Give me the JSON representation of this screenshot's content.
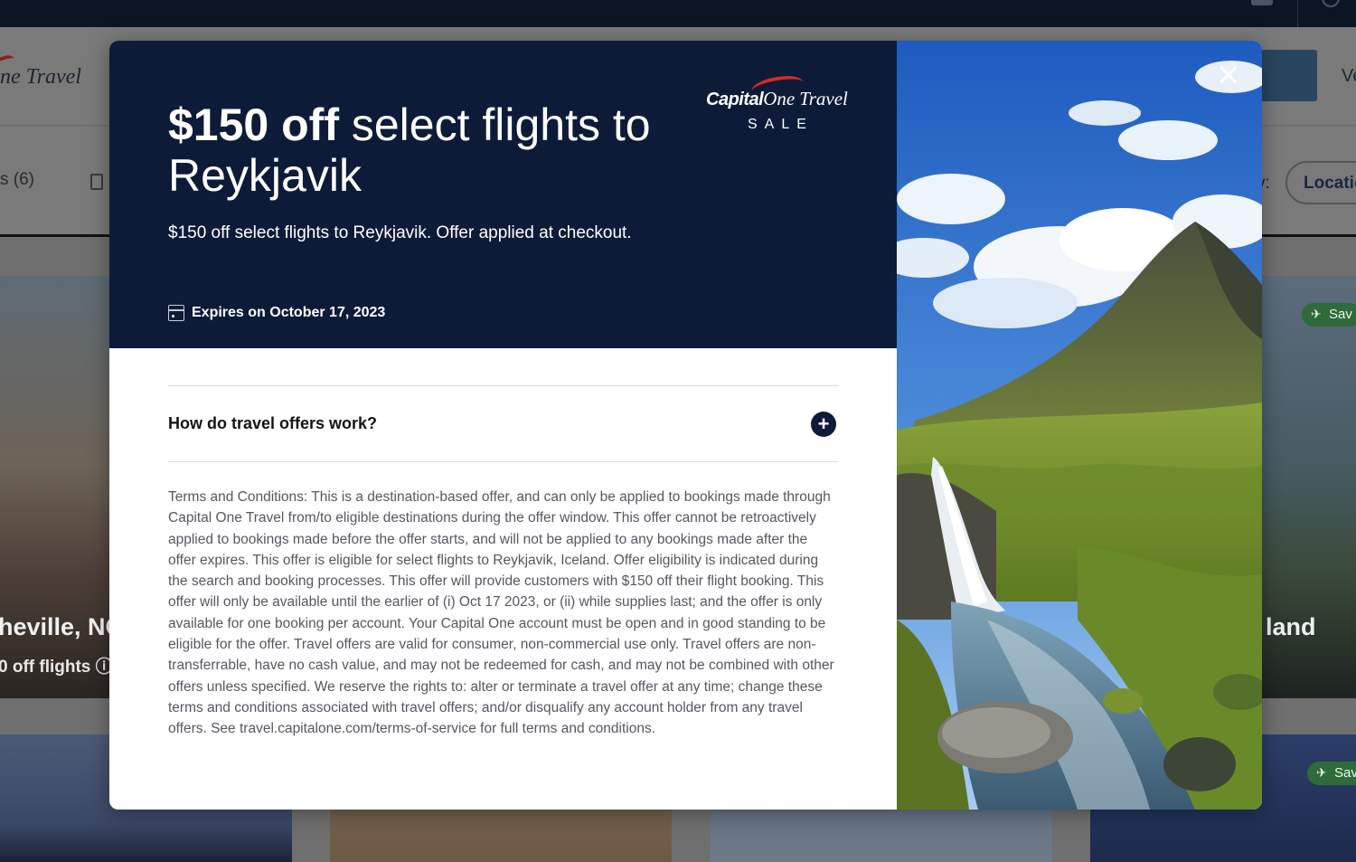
{
  "background": {
    "logo_text": "ne Travel",
    "header_right_text": "Ve",
    "filter_left_text": "s (6)",
    "sort_label": "y:",
    "sort_value": "Locatio",
    "left_tile": {
      "title": "heville, NC",
      "subtitle": "0 off flights ⓘ"
    },
    "right_tile": {
      "title": "land",
      "save_label": "Sav"
    },
    "right_tile_bottom": {
      "save_label": "Sav"
    }
  },
  "modal": {
    "title_bold": "$150 off",
    "title_rest": " select flights to Reykjavik",
    "subtitle": "$150 off select flights to Reykjavik. Offer applied at checkout.",
    "expiry": "Expires on October 17, 2023",
    "brand": {
      "capital": "Capital",
      "one": "One",
      "travel": "Travel",
      "sale": "SALE"
    },
    "faq_question": "How do travel offers work?",
    "faq_toggle": "+",
    "terms": "Terms and Conditions: This is a destination-based offer, and can only be applied to bookings made through Capital One Travel from/to eligible destinations during the offer window. This offer cannot be retroactively applied to bookings made before the offer starts, and will not be applied to any bookings made after the offer expires. This offer is eligible for select flights to Reykjavik, Iceland. Offer eligibility is indicated during the search and booking processes. This offer will provide customers with $150 off their flight booking. This offer will only be available until the earlier of (i) Oct 17 2023, or (ii) while supplies last; and the offer is only available for one booking per account. Your Capital One account must be open and in good standing to be eligible for the offer. Travel offers are valid for consumer, non-commercial use only. Travel offers are non-transferrable, have no cash value, and may not be redeemed for cash, and may not be combined with other offers unless specified. We reserve the rights to: alter or terminate a travel offer at any time; change these terms and conditions associated with travel offers; and/or disqualify any account holder from any travel offers. See travel.capitalone.com/terms-of-service for full terms and conditions.",
    "close_label": "✕",
    "image": "kirkjufell-waterfall-photo"
  },
  "colors": {
    "hero_bg": "#0e1b38",
    "brand_red": "#d22e1e",
    "text_dark": "#141414",
    "text_body": "#545860",
    "overlay": "#6f6f6f"
  }
}
